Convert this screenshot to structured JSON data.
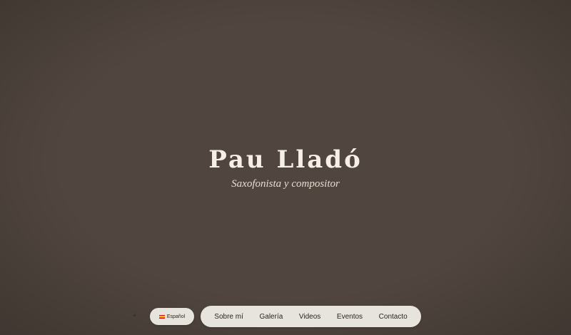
{
  "hero": {
    "title": "Pau Lladó",
    "subtitle": "Saxofonista y compositor"
  },
  "language": {
    "icon": "spain-flag-icon",
    "label": "Español"
  },
  "nav": {
    "items": [
      {
        "label": "Sobre mí"
      },
      {
        "label": "Galería"
      },
      {
        "label": "Videos"
      },
      {
        "label": "Eventos"
      },
      {
        "label": "Contacto"
      }
    ]
  },
  "colors": {
    "background": "#51463f",
    "title": "#f5efe6",
    "pill": "#e7e3dd"
  }
}
